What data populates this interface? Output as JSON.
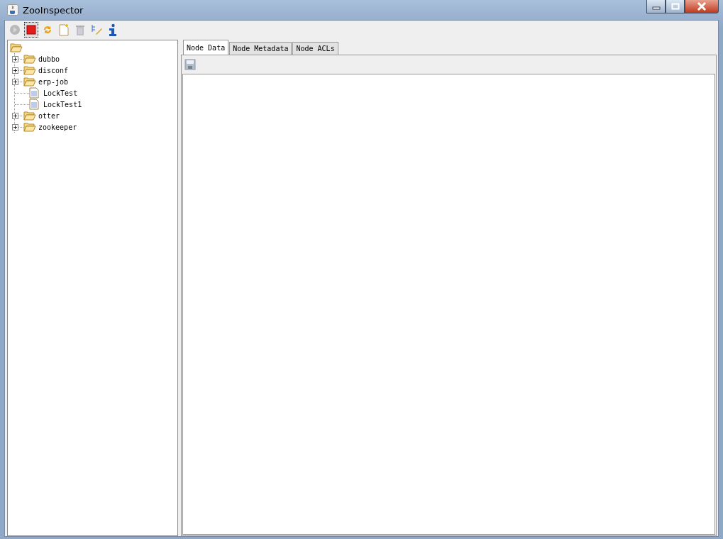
{
  "window": {
    "title": "ZooInspector"
  },
  "toolbar": [
    {
      "kind": "connect",
      "disabled": true,
      "pressed": false
    },
    {
      "kind": "disconnect",
      "disabled": false,
      "pressed": true
    },
    {
      "kind": "refresh",
      "disabled": false,
      "pressed": false
    },
    {
      "kind": "add",
      "disabled": false,
      "pressed": false
    },
    {
      "kind": "delete",
      "disabled": true,
      "pressed": false
    },
    {
      "kind": "edit",
      "disabled": false,
      "pressed": false
    },
    {
      "kind": "info",
      "disabled": false,
      "pressed": false
    }
  ],
  "tree": {
    "expanded": true,
    "children": [
      {
        "label": "dubbo",
        "kind": "folder",
        "expanded": false
      },
      {
        "label": "disconf",
        "kind": "folder",
        "expanded": false
      },
      {
        "label": "erp-job",
        "kind": "folder",
        "expanded": false
      },
      {
        "label": "LockTest",
        "kind": "file"
      },
      {
        "label": "LockTest1",
        "kind": "file"
      },
      {
        "label": "otter",
        "kind": "folder",
        "expanded": false
      },
      {
        "label": "zookeeper",
        "kind": "folder",
        "expanded": false
      }
    ]
  },
  "tabs": [
    {
      "label": "Node Data",
      "selected": true
    },
    {
      "label": "Node Metadata",
      "selected": false
    },
    {
      "label": "Node ACLs",
      "selected": false
    }
  ]
}
